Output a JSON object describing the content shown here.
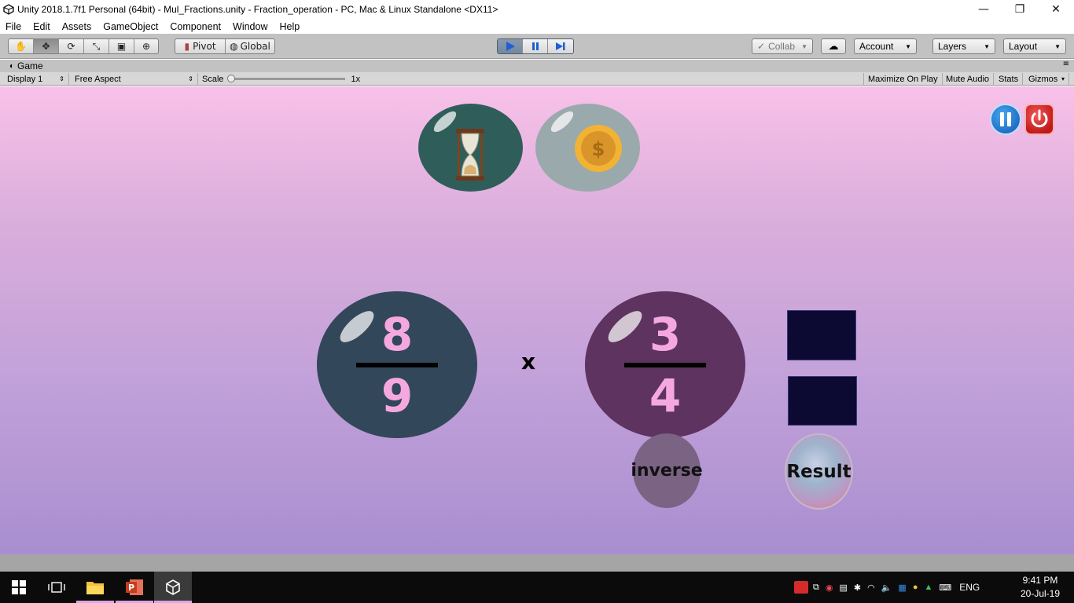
{
  "window": {
    "title": "Unity 2018.1.7f1 Personal (64bit) - Mul_Fractions.unity - Fraction_operation - PC, Mac & Linux Standalone <DX11>",
    "minimize": "—",
    "maximize": "❐",
    "close": "✕"
  },
  "menu": [
    "File",
    "Edit",
    "Assets",
    "GameObject",
    "Component",
    "Window",
    "Help"
  ],
  "toolbar": {
    "pivot_label": "Pivot",
    "global_label": "Global",
    "collab_label": "Collab",
    "account_label": "Account",
    "layers_label": "Layers",
    "layout_label": "Layout"
  },
  "game_view": {
    "tab_label": "Game",
    "display_label": "Display 1",
    "aspect_label": "Free Aspect",
    "scale_label": "Scale",
    "scale_value": "1x",
    "maximize_label": "Maximize On Play",
    "mute_label": "Mute Audio",
    "stats_label": "Stats",
    "gizmos_label": "Gizmos"
  },
  "game": {
    "fraction1": {
      "numerator": "8",
      "denominator": "9"
    },
    "operator": "x",
    "fraction2": {
      "numerator": "3",
      "denominator": "4"
    },
    "inverse_label": "inverse",
    "result_label": "Result",
    "colors": {
      "fraction1_bubble": "#33475a",
      "fraction2_bubble": "#5e3360",
      "timer_bubble": "#2f5e5a",
      "coin_bubble": "#9aa9ab",
      "answer_box": "#0c0a33"
    }
  },
  "taskbar": {
    "language": "ENG",
    "time": "9:41 PM",
    "date": "20-Jul-19"
  }
}
